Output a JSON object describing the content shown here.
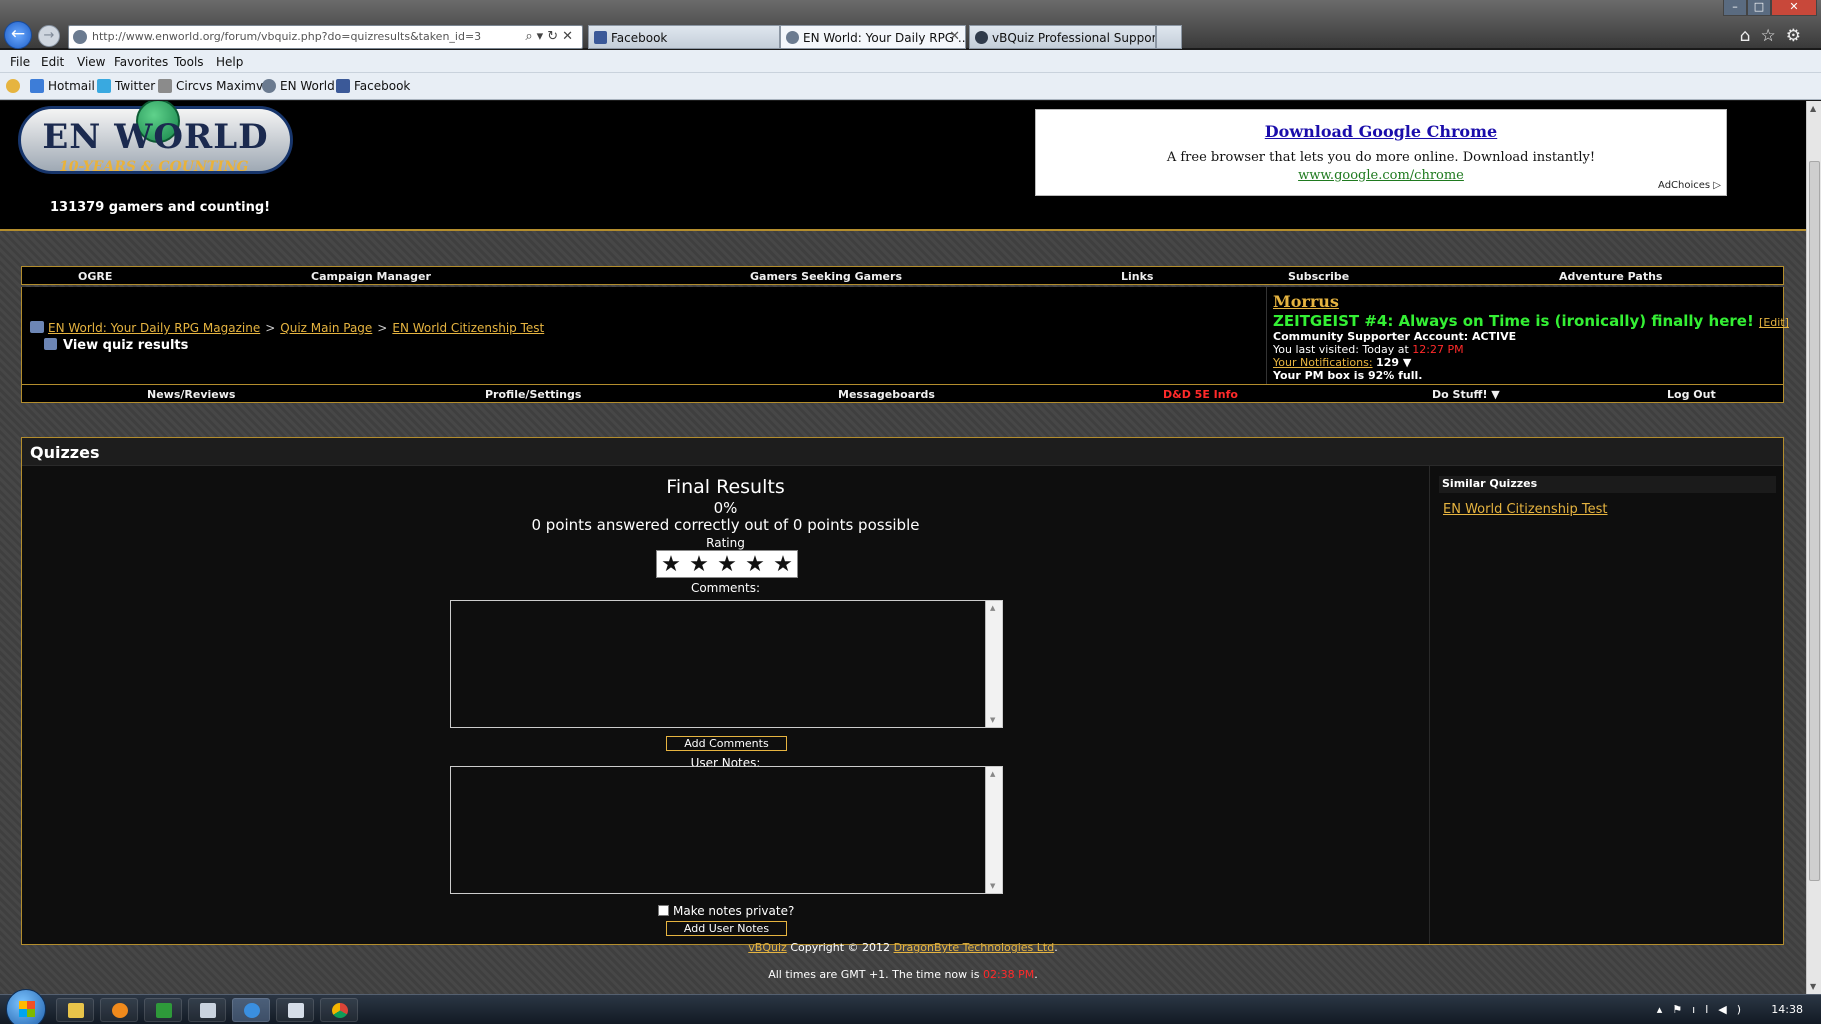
{
  "browser": {
    "url": "http://www.enworld.org/forum/vbquiz.php?do=quizresults&taken_id=3",
    "tabs": [
      {
        "label": "Facebook",
        "active": false
      },
      {
        "label": "EN World: Your Daily RPG ...",
        "active": true
      },
      {
        "label": "vBQuiz Professional Support",
        "active": false
      }
    ],
    "menu": [
      "File",
      "Edit",
      "View",
      "Favorites",
      "Tools",
      "Help"
    ],
    "favorites": [
      "Hotmail",
      "Twitter",
      "Circvs Maximvs",
      "EN World",
      "Facebook"
    ]
  },
  "header": {
    "logo_text": "EN WORLD",
    "logo_sub": "10-YEARS & COUNTING",
    "gamers_count": "131379 gamers and counting!"
  },
  "ad": {
    "title": "Download Google Chrome",
    "description": "A free browser that lets you do more online. Download instantly!",
    "link": "www.google.com/chrome",
    "choices": "AdChoices ▷"
  },
  "top_nav": [
    "OGRE",
    "Campaign Manager",
    "Gamers Seeking Gamers",
    "Links",
    "Subscribe",
    "Adventure Paths"
  ],
  "breadcrumb": {
    "items": [
      "EN World: Your Daily RPG Magazine",
      "Quiz Main Page",
      "EN World Citizenship Test"
    ],
    "separator": ">",
    "current": "View quiz results"
  },
  "user": {
    "name": "Morrus",
    "status": "ZEITGEIST #4: Always on Time is (ironically) finally here!",
    "edit": "[Edit]",
    "account": "Community Supporter Account: ACTIVE",
    "last_visited_label": "You last visited: Today at",
    "last_visited_time": "12:27 PM",
    "notifications_label": "Your Notifications:",
    "notifications_count": "129 ▼",
    "pm_box": "Your PM box is 92% full."
  },
  "bottom_nav": [
    {
      "label": "News/Reviews",
      "color": "#f0f0f0"
    },
    {
      "label": "Profile/Settings",
      "color": "#f0f0f0"
    },
    {
      "label": "Messageboards",
      "color": "#f0f0f0"
    },
    {
      "label": "D&D 5E Info",
      "color": "#ff2a2a"
    },
    {
      "label": "Do Stuff! ▼",
      "color": "#f0f0f0"
    },
    {
      "label": "Log Out",
      "color": "#f0f0f0"
    }
  ],
  "quiz": {
    "panel_title": "Quizzes",
    "final_title": "Final Results",
    "percent": "0%",
    "points_text": "0 points answered correctly out of 0 points possible",
    "rating_label": "Rating",
    "rating_max": 5,
    "comments_label": "Comments:",
    "add_comments": "Add Comments",
    "notes_label": "User Notes:",
    "private_label": "Make notes private?",
    "add_notes": "Add User Notes",
    "similar_title": "Similar Quizzes",
    "similar_link": "EN World Citizenship Test"
  },
  "footer": {
    "vbquiz": "vBQuiz",
    "copyright": "Copyright © 2012",
    "company": "DragonByte Technologies Ltd",
    "time_label": "All times are GMT +1. The time now is",
    "time_value": "02:38 PM"
  },
  "taskbar": {
    "clock": "14:38"
  }
}
